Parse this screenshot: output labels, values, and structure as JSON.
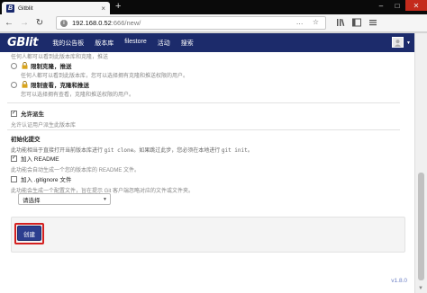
{
  "browser": {
    "tab_title": "Gitblit",
    "tab_close": "×",
    "new_tab": "+",
    "favicon": "B",
    "url_host": "192.168.0.52",
    "url_path": ":666/new/",
    "url_actions": "… ☆",
    "win_min": "–",
    "win_max": "□",
    "win_close": "✕",
    "back": "←",
    "forward": "→",
    "reload": "↻",
    "icons": [
      "library-icon",
      "sidebar-icon",
      "menu-icon"
    ]
  },
  "app": {
    "logo": "Blit",
    "logo_prefix": "G",
    "nav": [
      "我的公告板",
      "版本库",
      "filestore",
      "活动",
      "搜索"
    ],
    "avatar_glyph": "👤",
    "caret": "▼"
  },
  "form": {
    "cut_text": "任何人都可以看到此版本库和克隆，推送",
    "perm_options": [
      {
        "label": "限制克隆，推送",
        "desc": "任何人都可以看到此版本库，您可以选择拥有克隆和推送权限的用户。",
        "icon": "🔒"
      },
      {
        "label": "限制查看，克隆和推送",
        "desc": "您可以选择拥有查看，克隆和推送权限的用户。",
        "icon": "🔒"
      }
    ],
    "allow_fork": {
      "label": "允许派生",
      "desc": "允许认证用户派生此版本库",
      "checked": "✓"
    },
    "init_commit": {
      "heading": "初始化提交",
      "desc_before": "此功能相当于直接打开当前版本库进行 ",
      "desc_code1": "git clone",
      "desc_mid": "。如果跳过此步，您必须在本地进行 ",
      "desc_code2": "git init",
      "desc_after": "。"
    },
    "add_readme": {
      "label": "加入 README",
      "desc": "此功能会自动生成一个您的版本库的 README 文件。",
      "checked": "✓"
    },
    "add_gitignore": {
      "label": "加入 .gitignore 文件",
      "desc": "此功能会生成一个配置文件，旨在提示 Git 客户端忽略对应的文件或文件夹。",
      "checked": ""
    },
    "gitignore_select": {
      "selected": "请选择",
      "arrow": "▼"
    },
    "create_label": "创建"
  },
  "footer": {
    "version": "v1.8.0"
  }
}
